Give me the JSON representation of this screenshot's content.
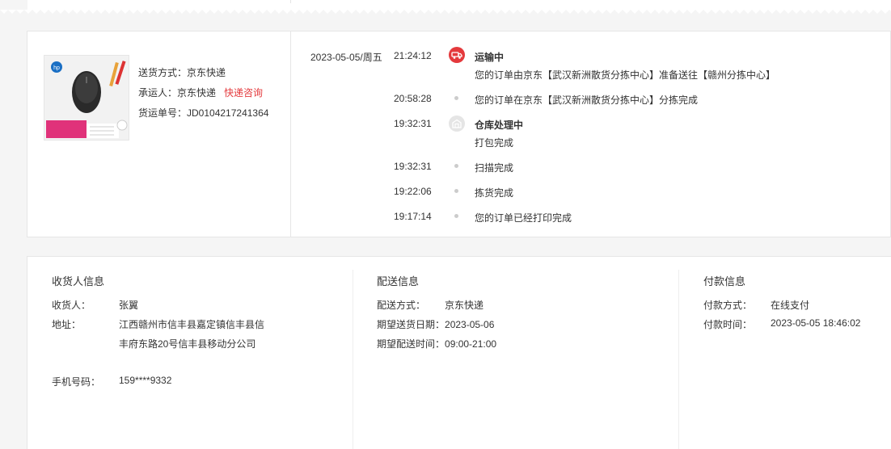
{
  "shipment": {
    "method_label": "送货方式：",
    "method": "京东快递",
    "carrier_label": "承运人：",
    "carrier": "京东快递",
    "consult_link": "快递咨询",
    "tracking_label": "货运单号：",
    "tracking_number": "JD0104217241364"
  },
  "timeline": [
    {
      "date": "2023-05-05/周五",
      "time": "21:24:12",
      "status": "运输中",
      "text": "您的订单由京东【武汉新洲散货分拣中心】准备送往【赣州分拣中心】",
      "icon": "truck-icon"
    },
    {
      "date": "",
      "time": "20:58:28",
      "status": "",
      "text": "您的订单在京东【武汉新洲散货分拣中心】分拣完成"
    },
    {
      "date": "",
      "time": "19:32:31",
      "status": "仓库处理中",
      "text": "打包完成",
      "icon": "warehouse-icon"
    },
    {
      "date": "",
      "time": "19:32:31",
      "status": "",
      "text": "扫描完成"
    },
    {
      "date": "",
      "time": "19:22:06",
      "status": "",
      "text": "拣货完成"
    },
    {
      "date": "",
      "time": "19:17:14",
      "status": "",
      "text": "您的订单已经打印完成"
    }
  ],
  "receiver": {
    "title": "收货人信息",
    "name_label": "收货人：",
    "name": "张翼",
    "address_label": "地址：",
    "address": "江西赣州市信丰县嘉定镇信丰县信丰府东路20号信丰县移动分公司",
    "phone_label": "手机号码：",
    "phone": "159****9332"
  },
  "delivery": {
    "title": "配送信息",
    "method_label": "配送方式：",
    "method": "京东快递",
    "date_label": "期望送货日期：",
    "date": "2023-05-06",
    "time_label": "期望配送时间：",
    "time": "09:00-21:00"
  },
  "payment": {
    "title": "付款信息",
    "method_label": "付款方式：",
    "method": "在线支付",
    "time_label": "付款时间：",
    "time": "2023-05-05 18:46:02"
  },
  "colors": {
    "accent_red": "#e4393c",
    "divider": "#e6e6e6"
  }
}
